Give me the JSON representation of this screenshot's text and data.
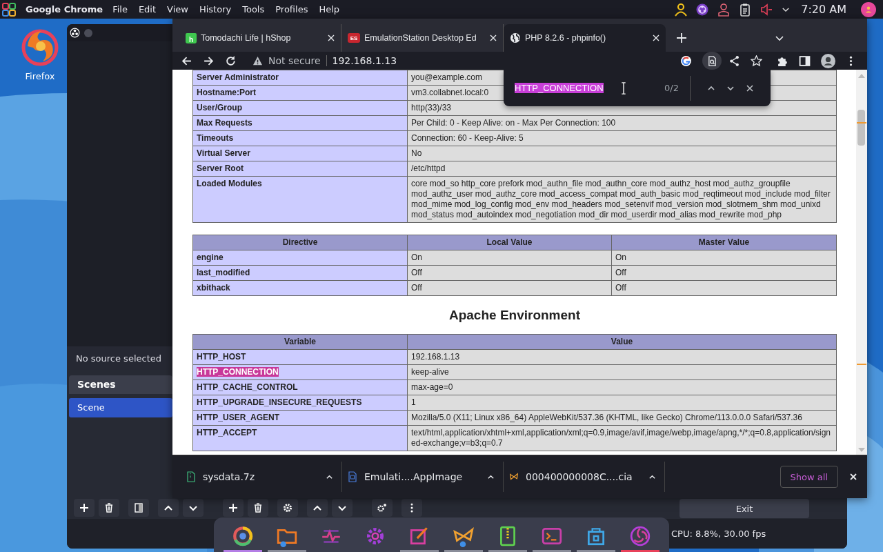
{
  "top_panel": {
    "app_name": "Google Chrome",
    "menu": [
      "File",
      "Edit",
      "View",
      "History",
      "Tools",
      "Profiles",
      "Help"
    ],
    "clock": "7:20 AM"
  },
  "desktop": {
    "icons": [
      {
        "label": "Firefox"
      }
    ]
  },
  "obs": {
    "source_bar": "No source selected",
    "scenes": {
      "title": "Scenes",
      "items": [
        {
          "label": "Scene",
          "selected": true
        }
      ]
    },
    "exit_button": "Exit",
    "status": "CPU: 8.8%, 30.00 fps"
  },
  "chrome": {
    "tabs": [
      {
        "title": "Tomodachi Life | hShop",
        "kind": "bag",
        "icon_text": "h",
        "selected": false
      },
      {
        "title": "EmulationStation Desktop Ed",
        "kind": "badge",
        "icon_text": "ES",
        "selected": false
      },
      {
        "title": "PHP 8.2.6 - phpinfo()",
        "kind": "globe",
        "selected": true
      }
    ],
    "address": {
      "security": "Not secure",
      "url": "192.168.1.13"
    },
    "find_bar": {
      "query": "HTTP_CONNECTION",
      "count": "0/2"
    },
    "page": {
      "server_rows": [
        {
          "key": "Server Administrator",
          "value": "you@example.com"
        },
        {
          "key": "Hostname:Port",
          "value": "vm3.collabnet.local:0"
        },
        {
          "key": "User/Group",
          "value": "http(33)/33"
        },
        {
          "key": "Max Requests",
          "value": "Per Child: 0 - Keep Alive: on - Max Per Connection: 100"
        },
        {
          "key": "Timeouts",
          "value": "Connection: 60 - Keep-Alive: 5"
        },
        {
          "key": "Virtual Server",
          "value": "No"
        },
        {
          "key": "Server Root",
          "value": "/etc/httpd"
        },
        {
          "key": "Loaded Modules",
          "value": "core mod_so http_core prefork mod_authn_file mod_authn_core mod_authz_host mod_authz_groupfile mod_authz_user mod_authz_core mod_access_compat mod_auth_basic mod_reqtimeout mod_include mod_filter mod_mime mod_log_config mod_env mod_headers mod_setenvif mod_version mod_slotmem_shm mod_unixd mod_status mod_autoindex mod_negotiation mod_dir mod_userdir mod_alias mod_rewrite mod_php"
        }
      ],
      "directive_table": {
        "columns": [
          "Directive",
          "Local Value",
          "Master Value"
        ],
        "rows": [
          [
            "engine",
            "On",
            "On"
          ],
          [
            "last_modified",
            "Off",
            "Off"
          ],
          [
            "xbithack",
            "Off",
            "Off"
          ]
        ]
      },
      "heading": "Apache Environment",
      "env_table": {
        "columns": [
          "Variable",
          "Value"
        ],
        "rows": [
          {
            "key": "HTTP_HOST",
            "value": "192.168.1.13",
            "highlighted": false
          },
          {
            "key": "HTTP_CONNECTION",
            "value": "keep-alive",
            "highlighted": true
          },
          {
            "key": "HTTP_CACHE_CONTROL",
            "value": "max-age=0",
            "highlighted": false
          },
          {
            "key": "HTTP_UPGRADE_INSECURE_REQUESTS",
            "value": "1",
            "highlighted": false
          },
          {
            "key": "HTTP_USER_AGENT",
            "value": "Mozilla/5.0 (X11; Linux x86_64) AppleWebKit/537.36 (KHTML, like Gecko) Chrome/113.0.0.0 Safari/537.36",
            "highlighted": false
          },
          {
            "key": "HTTP_ACCEPT",
            "value": "text/html,application/xhtml+xml,application/xml;q=0.9,image/avif,image/webp,image/apng,*/*;q=0.8,application/signed-exchange;v=b3;q=0.7",
            "highlighted": false
          }
        ]
      }
    },
    "downloads": [
      {
        "name": "sysdata.7z",
        "kind": "archive"
      },
      {
        "name": "Emulati....AppImage",
        "kind": "app"
      },
      {
        "name": "000400000008C....cia",
        "kind": "butterfly"
      }
    ],
    "show_all": "Show all"
  },
  "dock": [
    {
      "kind": "chrome",
      "color": "#b47ee5"
    },
    {
      "kind": "files",
      "color": "#8a8d99"
    },
    {
      "kind": "monitor"
    },
    {
      "kind": "settings"
    },
    {
      "kind": "notes",
      "color": "#8a8d99"
    },
    {
      "kind": "butterfly",
      "color": "#8a8d99"
    },
    {
      "kind": "archive",
      "color": "#8a8d99"
    },
    {
      "kind": "terminal",
      "color": "#8a8d99"
    },
    {
      "kind": "store",
      "color": "#8a8d99"
    },
    {
      "kind": "obs",
      "color": "#e8415a"
    }
  ]
}
